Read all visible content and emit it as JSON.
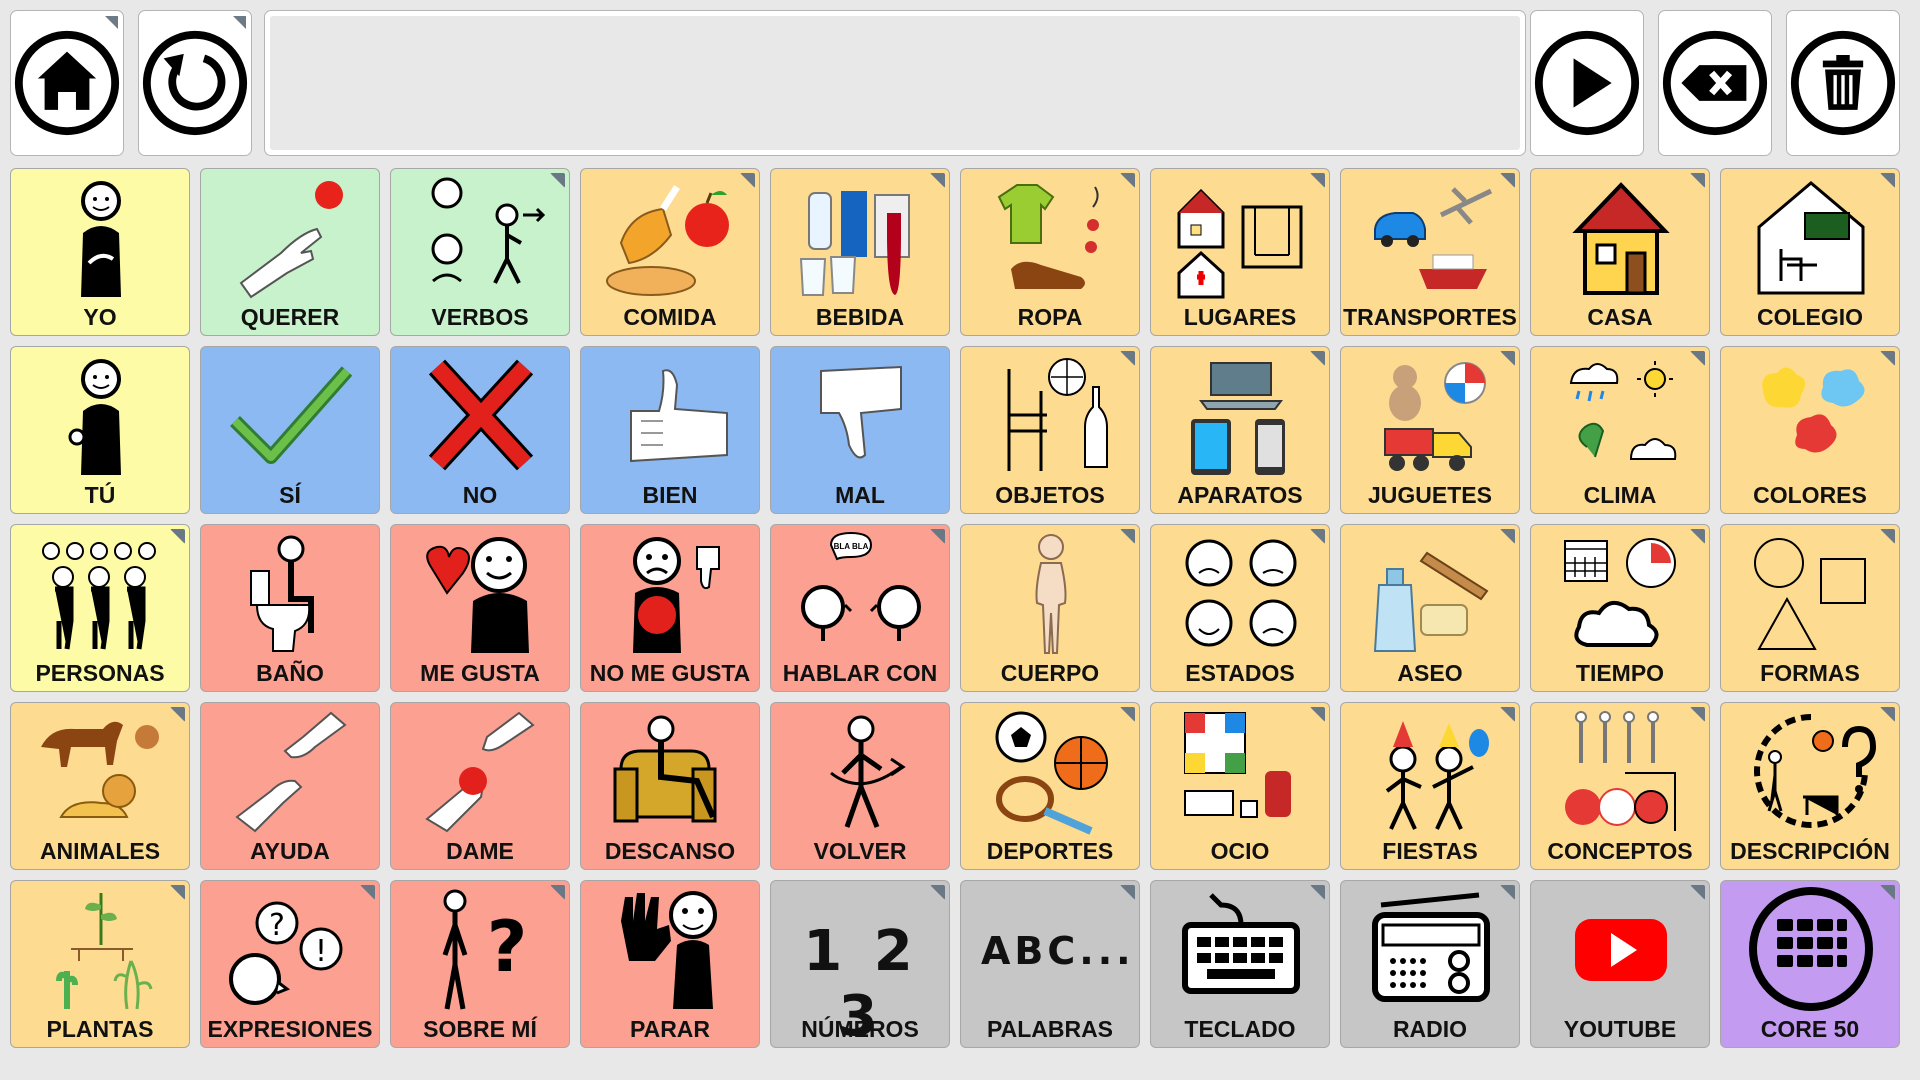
{
  "toolbar": {
    "left": [
      {
        "name": "home-button",
        "icon": "home-icon"
      },
      {
        "name": "undo-button",
        "icon": "undo-icon"
      }
    ],
    "right": [
      {
        "name": "speak-button",
        "icon": "play-icon"
      },
      {
        "name": "backspace-button",
        "icon": "backspace-icon"
      },
      {
        "name": "clear-button",
        "icon": "trash-icon"
      }
    ]
  },
  "message_bar": {
    "text": ""
  },
  "colors": {
    "yellow": "#fdfba5",
    "green": "#c8f2cb",
    "orange": "#fddc91",
    "blue": "#8db9f2",
    "red": "#fca091",
    "gray": "#c6c6c6",
    "purple": "#c39cf2"
  },
  "grid": [
    [
      {
        "label": "YO",
        "color": "yellow",
        "icon": "person-me-icon",
        "folder": false
      },
      {
        "label": "QUERER",
        "color": "green",
        "icon": "hand-reach-ball-icon",
        "folder": false
      },
      {
        "label": "VERBOS",
        "color": "green",
        "icon": "actions-icon",
        "folder": true
      },
      {
        "label": "COMIDA",
        "color": "orange",
        "icon": "food-icon",
        "folder": true
      },
      {
        "label": "BEBIDA",
        "color": "orange",
        "icon": "drinks-icon",
        "folder": true
      },
      {
        "label": "ROPA",
        "color": "orange",
        "icon": "clothes-icon",
        "folder": true
      },
      {
        "label": "LUGARES",
        "color": "orange",
        "icon": "places-icon",
        "folder": true
      },
      {
        "label": "TRANSPORTES",
        "color": "orange",
        "icon": "transport-icon",
        "folder": true
      },
      {
        "label": "CASA",
        "color": "orange",
        "icon": "house-icon",
        "folder": true
      },
      {
        "label": "COLEGIO",
        "color": "orange",
        "icon": "school-icon",
        "folder": true
      }
    ],
    [
      {
        "label": "TÚ",
        "color": "yellow",
        "icon": "person-you-icon",
        "folder": false
      },
      {
        "label": "SÍ",
        "color": "blue",
        "icon": "checkmark-icon",
        "folder": false
      },
      {
        "label": "NO",
        "color": "blue",
        "icon": "cross-icon",
        "folder": false
      },
      {
        "label": "BIEN",
        "color": "blue",
        "icon": "thumbs-up-icon",
        "folder": false
      },
      {
        "label": "MAL",
        "color": "blue",
        "icon": "thumbs-down-icon",
        "folder": false
      },
      {
        "label": "OBJETOS",
        "color": "orange",
        "icon": "objects-icon",
        "folder": true
      },
      {
        "label": "APARATOS",
        "color": "orange",
        "icon": "devices-icon",
        "folder": true
      },
      {
        "label": "JUGUETES",
        "color": "orange",
        "icon": "toys-icon",
        "folder": true
      },
      {
        "label": "CLIMA",
        "color": "orange",
        "icon": "weather-icon",
        "folder": true
      },
      {
        "label": "COLORES",
        "color": "orange",
        "icon": "paint-splash-icon",
        "folder": true
      }
    ],
    [
      {
        "label": "PERSONAS",
        "color": "yellow",
        "icon": "people-icon",
        "folder": true
      },
      {
        "label": "BAÑO",
        "color": "red",
        "icon": "toilet-icon",
        "folder": false
      },
      {
        "label": "ME GUSTA",
        "color": "red",
        "icon": "like-icon",
        "folder": false
      },
      {
        "label": "NO ME GUSTA",
        "color": "red",
        "icon": "dislike-icon",
        "folder": false
      },
      {
        "label": "HABLAR CON",
        "color": "red",
        "icon": "talk-icon",
        "folder": true
      },
      {
        "label": "CUERPO",
        "color": "orange",
        "icon": "body-icon",
        "folder": true
      },
      {
        "label": "ESTADOS",
        "color": "orange",
        "icon": "emotions-icon",
        "folder": true
      },
      {
        "label": "ASEO",
        "color": "orange",
        "icon": "hygiene-icon",
        "folder": true
      },
      {
        "label": "TIEMPO",
        "color": "orange",
        "icon": "time-icon",
        "folder": true
      },
      {
        "label": "FORMAS",
        "color": "orange",
        "icon": "shapes-icon",
        "folder": true
      }
    ],
    [
      {
        "label": "ANIMALES",
        "color": "orange",
        "icon": "animals-icon",
        "folder": true
      },
      {
        "label": "AYUDA",
        "color": "red",
        "icon": "help-hands-icon",
        "folder": false
      },
      {
        "label": "DAME",
        "color": "red",
        "icon": "give-icon",
        "folder": false
      },
      {
        "label": "DESCANSO",
        "color": "red",
        "icon": "rest-icon",
        "folder": false
      },
      {
        "label": "VOLVER",
        "color": "red",
        "icon": "return-icon",
        "folder": false
      },
      {
        "label": "DEPORTES",
        "color": "orange",
        "icon": "sports-icon",
        "folder": true
      },
      {
        "label": "OCIO",
        "color": "orange",
        "icon": "leisure-icon",
        "folder": true
      },
      {
        "label": "FIESTAS",
        "color": "orange",
        "icon": "party-icon",
        "folder": true
      },
      {
        "label": "CONCEPTOS",
        "color": "orange",
        "icon": "concepts-icon",
        "folder": true
      },
      {
        "label": "DESCRIPCIÓN",
        "color": "orange",
        "icon": "description-icon",
        "folder": true
      }
    ],
    [
      {
        "label": "PLANTAS",
        "color": "orange",
        "icon": "plants-icon",
        "folder": true
      },
      {
        "label": "EXPRESIONES",
        "color": "red",
        "icon": "expressions-icon",
        "folder": true
      },
      {
        "label": "SOBRE MÍ",
        "color": "red",
        "icon": "about-me-icon",
        "folder": true
      },
      {
        "label": "PARAR",
        "color": "red",
        "icon": "stop-hand-icon",
        "folder": false
      },
      {
        "label": "NÚMEROS",
        "color": "gray",
        "icon": "numbers-icon",
        "folder": true,
        "icon_text": "1 2 3"
      },
      {
        "label": "PALABRAS",
        "color": "gray",
        "icon": "words-icon",
        "folder": true,
        "icon_text": "ABC..."
      },
      {
        "label": "TECLADO",
        "color": "gray",
        "icon": "keyboard-icon",
        "folder": true
      },
      {
        "label": "RADIO",
        "color": "gray",
        "icon": "radio-icon",
        "folder": true
      },
      {
        "label": "YOUTUBE",
        "color": "gray",
        "icon": "youtube-icon",
        "folder": true
      },
      {
        "label": "CORE 50",
        "color": "purple",
        "icon": "core-grid-icon",
        "folder": true
      }
    ]
  ]
}
